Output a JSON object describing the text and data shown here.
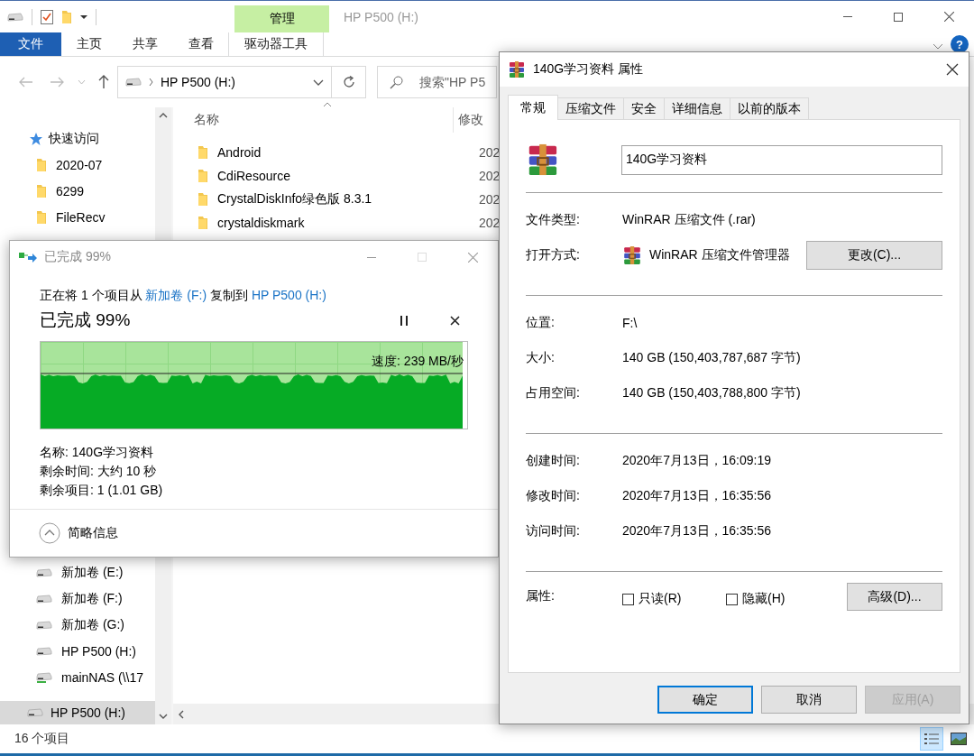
{
  "explorer": {
    "title": "HP P500 (H:)",
    "context_tab": "管理",
    "ribbon_tabs": [
      {
        "label": "文件",
        "kind": "file"
      },
      {
        "label": "主页",
        "kind": "tab"
      },
      {
        "label": "共享",
        "kind": "tab"
      },
      {
        "label": "查看",
        "kind": "tab"
      },
      {
        "label": "驱动器工具",
        "kind": "context"
      }
    ],
    "help": "?",
    "address": "HP P500 (H:)",
    "search": {
      "placeholder": "搜索\"HP P5"
    },
    "columns": [
      "名称",
      "修改"
    ],
    "files": [
      {
        "name": "Android",
        "date": "202"
      },
      {
        "name": "CdiResource",
        "date": "202"
      },
      {
        "name": "CrystalDiskInfo绿色版 8.3.1",
        "date": "202"
      },
      {
        "name": "crystaldiskmark",
        "date": "202"
      }
    ],
    "nav_top": [
      {
        "label": "快速访问",
        "kind": "star"
      },
      {
        "label": "2020-07",
        "kind": "folder"
      },
      {
        "label": "6299",
        "kind": "folder"
      },
      {
        "label": "FileRecv",
        "kind": "folder"
      }
    ],
    "nav_drives": [
      {
        "label": "新加卷 (E:)",
        "kind": "drive"
      },
      {
        "label": "新加卷 (F:)",
        "kind": "drive"
      },
      {
        "label": "新加卷 (G:)",
        "kind": "drive"
      },
      {
        "label": "HP P500 (H:)",
        "kind": "drive"
      },
      {
        "label": "mainNAS (\\\\17",
        "kind": "network"
      }
    ],
    "nav_pinned": {
      "label": "HP P500 (H:)",
      "selected": true
    },
    "status": "16 个项目",
    "views": [
      {
        "kind": "details",
        "selected": true
      },
      {
        "kind": "thumbnails",
        "selected": false
      }
    ]
  },
  "copy": {
    "title": "已完成 99%",
    "message": [
      {
        "text": "正在将 1 个项目从 ",
        "kind": "plain"
      },
      {
        "text": "新加卷 (F:)",
        "kind": "link"
      },
      {
        "text": " 复制到 ",
        "kind": "plain"
      },
      {
        "text": "HP P500 (H:)",
        "kind": "link"
      }
    ],
    "heading": "已完成 99%",
    "level": 0.99,
    "speed": "速度: 239 MB/秒",
    "details": [
      "名称: 140G学习资料",
      "剩余时间: 大约 10 秒",
      "剩余项目: 1 (1.01 GB)"
    ],
    "toggle": "简略信息"
  },
  "properties": {
    "title": "140G学习资料 属性",
    "tabs": [
      {
        "label": "常规",
        "selected": true
      },
      {
        "label": "压缩文件",
        "selected": false
      },
      {
        "label": "安全",
        "selected": false
      },
      {
        "label": "详细信息",
        "selected": false
      },
      {
        "label": "以前的版本",
        "selected": false
      }
    ],
    "name": "140G学习资料",
    "sections": [
      [
        {
          "kind": "text",
          "label": "文件类型:",
          "value": "WinRAR 压缩文件 (.rar)"
        },
        {
          "kind": "app",
          "label": "打开方式:",
          "value": "WinRAR 压缩文件管理器",
          "button": "更改(C)..."
        }
      ],
      [
        {
          "kind": "text",
          "label": "位置:",
          "value": "F:\\"
        },
        {
          "kind": "text",
          "label": "大小:",
          "value": "140 GB (150,403,787,687 字节)"
        },
        {
          "kind": "text",
          "label": "占用空间:",
          "value": "140 GB (150,403,788,800 字节)"
        }
      ],
      [
        {
          "kind": "text",
          "label": "创建时间:",
          "value": "2020年7月13日，16:09:19"
        },
        {
          "kind": "text",
          "label": "修改时间:",
          "value": "2020年7月13日，16:35:56"
        },
        {
          "kind": "text",
          "label": "访问时间:",
          "value": "2020年7月13日，16:35:56"
        }
      ],
      [
        {
          "kind": "attributes",
          "label": "属性:",
          "checkboxes": [
            {
              "label": "只读(R)",
              "checked": false
            },
            {
              "label": "隐藏(H)",
              "checked": false
            }
          ],
          "button": "高级(D)..."
        }
      ]
    ],
    "buttons": [
      {
        "label": "确定",
        "default": true,
        "disabled": false
      },
      {
        "label": "取消",
        "default": false,
        "disabled": false
      },
      {
        "label": "应用(A)",
        "default": false,
        "disabled": true
      }
    ]
  }
}
